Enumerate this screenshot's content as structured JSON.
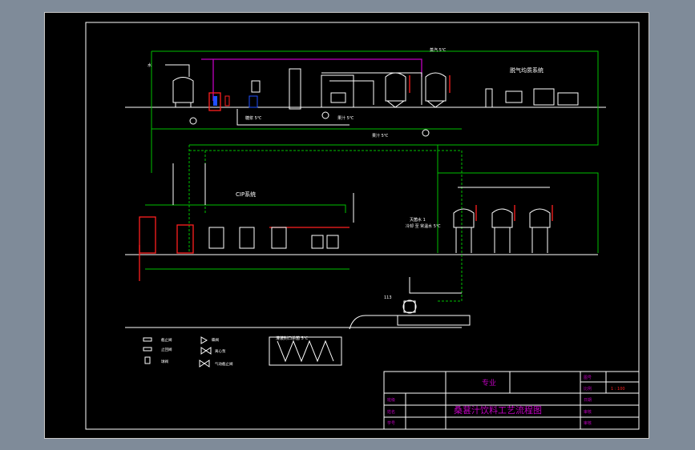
{
  "title_block": {
    "main_title": "桑葚汁饮料工艺流程图",
    "specialty_label": "专业",
    "scale_label": "比例",
    "scale_value": "1 : 100",
    "row_top": "图号",
    "row_date": "日期",
    "row_design": "设计",
    "row_check": "校核",
    "row_audit": "审核",
    "row_review": "审核",
    "row_student": "学号",
    "row_class": "班级",
    "row_name": "姓名"
  },
  "labels": {
    "cip_system": "CIP系统",
    "degas_system": "脱气均质系统",
    "steam_top": "蒸汽 5℃",
    "water_left": "水",
    "syrup": "糖浆 5℃",
    "juice": "果汁 5℃",
    "mid_flow": "果汁 5℃",
    "filling_label": "灌装封口杀菌 5℃",
    "aseptic_tank": "无菌罐 5℃",
    "tank_cluster_label": "净化车间",
    "right_note": "灭菌水 1",
    "right_note2": "冷却 至 常温水 5℃",
    "bottle_label": "113",
    "legend_gate": "截止阀",
    "legend_check": "止回阀",
    "legend_ball": "球阀",
    "legend_butterfly": "蝶阀",
    "legend_pump": "离心泵",
    "legend_pneumatic": "气动截止阀"
  },
  "colors": {
    "green": "#00c000",
    "white": "#ffffff",
    "magenta": "#c000c0",
    "red": "#ff2020",
    "blue": "#2050ff",
    "yellow": "#e0e000"
  }
}
